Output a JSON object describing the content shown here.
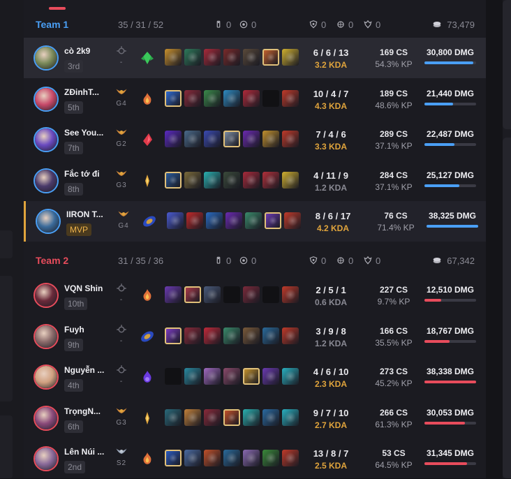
{
  "teams": [
    {
      "name": "Team 1",
      "color": "#4a9ff5",
      "score": "35 / 31 / 52",
      "objectives": {
        "towers": "0",
        "inhibitors": "0",
        "barons": "0",
        "heralds": "0",
        "dragons": "0"
      },
      "gold": "73,479",
      "players": [
        {
          "name": "cò 2k9",
          "place": "3rd",
          "rank_text": "-",
          "rank_icon": "unranked-icon",
          "spell": "green-crystal-icon",
          "kd": "6 / 6 / 13",
          "kda": "3.2 KDA",
          "kda_tier": "gold",
          "cs": "169 CS",
          "kp": "54.3% KP",
          "dmg": "30,800 DMG",
          "dmg_share": 0.95,
          "highlighted": true,
          "face_color": "#7a8a5a",
          "items": [
            "#c7902e",
            "#2e7a5a",
            "#a82a3a",
            "#7a2a2a",
            "#5a4a3a",
            "#c0602e",
            "#d0b030"
          ],
          "trinket_index": 5
        },
        {
          "name": "ZĐinhT...",
          "place": "5th",
          "rank_text": "G4",
          "rank_icon": "gold-rank-icon",
          "spell": "orange-flame-icon",
          "kd": "10 / 4 / 7",
          "kda": "4.3 KDA",
          "kda_tier": "gold",
          "cs": "189 CS",
          "kp": "48.6% KP",
          "dmg": "21,440 DMG",
          "dmg_share": 0.55,
          "face_color": "#c84a6a",
          "items": [
            "#2e6ad0",
            "#8a2a3a",
            "#3a8a4a",
            "#2e8ac0",
            "#b02a3a",
            "#111114",
            "#c03a2a"
          ],
          "trinket_index": 0
        },
        {
          "name": "See You...",
          "place": "7th",
          "rank_text": "G2",
          "rank_icon": "gold-rank-icon",
          "spell": "red-crystal-icon",
          "kd": "7 / 4 / 6",
          "kda": "3.3 KDA",
          "kda_tier": "gold",
          "cs": "289 CS",
          "kp": "37.1% KP",
          "dmg": "22,487 DMG",
          "dmg_share": 0.58,
          "face_color": "#6a4ac0",
          "items": [
            "#5a2ac0",
            "#4a6a8a",
            "#3a4ab0",
            "#7a8aa0",
            "#6a2ab0",
            "#c0902e",
            "#c03a2a"
          ],
          "trinket_index": 3
        },
        {
          "name": "Fắc tớ đi",
          "place": "8th",
          "rank_text": "G3",
          "rank_icon": "gold-rank-icon",
          "spell": "gold-flame-icon",
          "kd": "4 / 11 / 9",
          "kda": "1.2 KDA",
          "kda_tier": "gray",
          "cs": "284 CS",
          "kp": "37.1% KP",
          "dmg": "25,127 DMG",
          "dmg_share": 0.68,
          "face_color": "#4a3a6a",
          "items": [
            "#2a5a9a",
            "#7a6a3a",
            "#2ab0b0",
            "#3a4a3a",
            "#a82a3a",
            "#b0303a",
            "#d0b030"
          ],
          "trinket_index": 0
        },
        {
          "name": "IIRON T...",
          "place": "MVP",
          "rank_text": "G4",
          "rank_icon": "gold-rank-icon",
          "spell": "blue-orb-icon",
          "kd": "8 / 6 / 17",
          "kda": "4.2 KDA",
          "kda_tier": "gold",
          "cs": "76 CS",
          "kp": "71.4% KP",
          "dmg": "38,325 DMG",
          "dmg_share": 1.0,
          "mvp": true,
          "face_color": "#3a6a9a",
          "items": [
            "#4a5ad0",
            "#c02a2a",
            "#2a6ac0",
            "#6a2ab0",
            "#3a8a6a",
            "#6a3ab0",
            "#c03a2a"
          ],
          "trinket_index": 5
        }
      ]
    },
    {
      "name": "Team 2",
      "color": "#e84c5c",
      "score": "31 / 35 / 36",
      "objectives": {
        "towers": "0",
        "inhibitors": "0",
        "barons": "0",
        "heralds": "0",
        "dragons": "0"
      },
      "gold": "67,342",
      "players": [
        {
          "name": "VQN Shin",
          "place": "10th",
          "rank_text": "-",
          "rank_icon": "unranked-icon",
          "spell": "orange-flame-icon",
          "kd": "2 / 5 / 1",
          "kda": "0.6 KDA",
          "kda_tier": "gray",
          "cs": "227 CS",
          "kp": "9.7% KP",
          "dmg": "12,510 DMG",
          "dmg_share": 0.33,
          "face_color": "#6a2a3a",
          "items": [
            "#6a3ab0",
            "#a83a4a",
            "#4a5a7a",
            "#111114",
            "#7a2a3a",
            "#111114",
            "#c03a2a"
          ],
          "trinket_index": 1
        },
        {
          "name": "Fuyh",
          "place": "9th",
          "rank_text": "-",
          "rank_icon": "unranked-icon",
          "spell": "blue-orb-icon",
          "kd": "3 / 9 / 8",
          "kda": "1.2 KDA",
          "kda_tier": "gray",
          "cs": "166 CS",
          "kp": "35.5% KP",
          "dmg": "18,767 DMG",
          "dmg_share": 0.49,
          "face_color": "#8a6a6a",
          "items": [
            "#7a3ac0",
            "#8a2a3a",
            "#c02a3a",
            "#3a8a6a",
            "#7a5a3a",
            "#2a6a9a",
            "#c03a2a"
          ],
          "trinket_index": 0
        },
        {
          "name": "Nguyễn ...",
          "place": "4th",
          "rank_text": "-",
          "rank_icon": "unranked-icon",
          "spell": "purple-flame-icon",
          "kd": "4 / 6 / 10",
          "kda": "2.3 KDA",
          "kda_tier": "gold",
          "cs": "273 CS",
          "kp": "45.2% KP",
          "dmg": "38,338 DMG",
          "dmg_share": 1.0,
          "face_color": "#d0a080",
          "items": [
            "#111114",
            "#2a8aa0",
            "#a06ac0",
            "#8a4a6a",
            "#c0902e",
            "#6a3ab0",
            "#2ab0c0"
          ],
          "trinket_index": 4
        },
        {
          "name": "TrọngN...",
          "place": "6th",
          "rank_text": "G3",
          "rank_icon": "gold-rank-icon",
          "spell": "gold-flame-icon",
          "kd": "9 / 7 / 10",
          "kda": "2.7 KDA",
          "kda_tier": "gold",
          "cs": "266 CS",
          "kp": "61.3% KP",
          "dmg": "30,053 DMG",
          "dmg_share": 0.78,
          "face_color": "#8a4a7a",
          "items": [
            "#2a6a7a",
            "#c0803a",
            "#8a2a3a",
            "#c0502a",
            "#2ab0b0",
            "#2a6aa0",
            "#2ab0c0"
          ],
          "trinket_index": 3
        },
        {
          "name": "Lên Núi ...",
          "place": "2nd",
          "rank_text": "S2",
          "rank_icon": "silver-rank-icon",
          "spell": "orange-flame-icon",
          "kd": "13 / 8 / 7",
          "kda": "2.5 KDA",
          "kda_tier": "gold",
          "cs": "53 CS",
          "kp": "64.5% KP",
          "dmg": "31,345 DMG",
          "dmg_share": 0.82,
          "face_color": "#8a6a9a",
          "items": [
            "#2a5ac0",
            "#4a6aa0",
            "#c0502a",
            "#2a6a9a",
            "#8a6ab0",
            "#3a8a3a",
            "#c03a2a"
          ],
          "trinket_index": 0
        }
      ]
    }
  ]
}
